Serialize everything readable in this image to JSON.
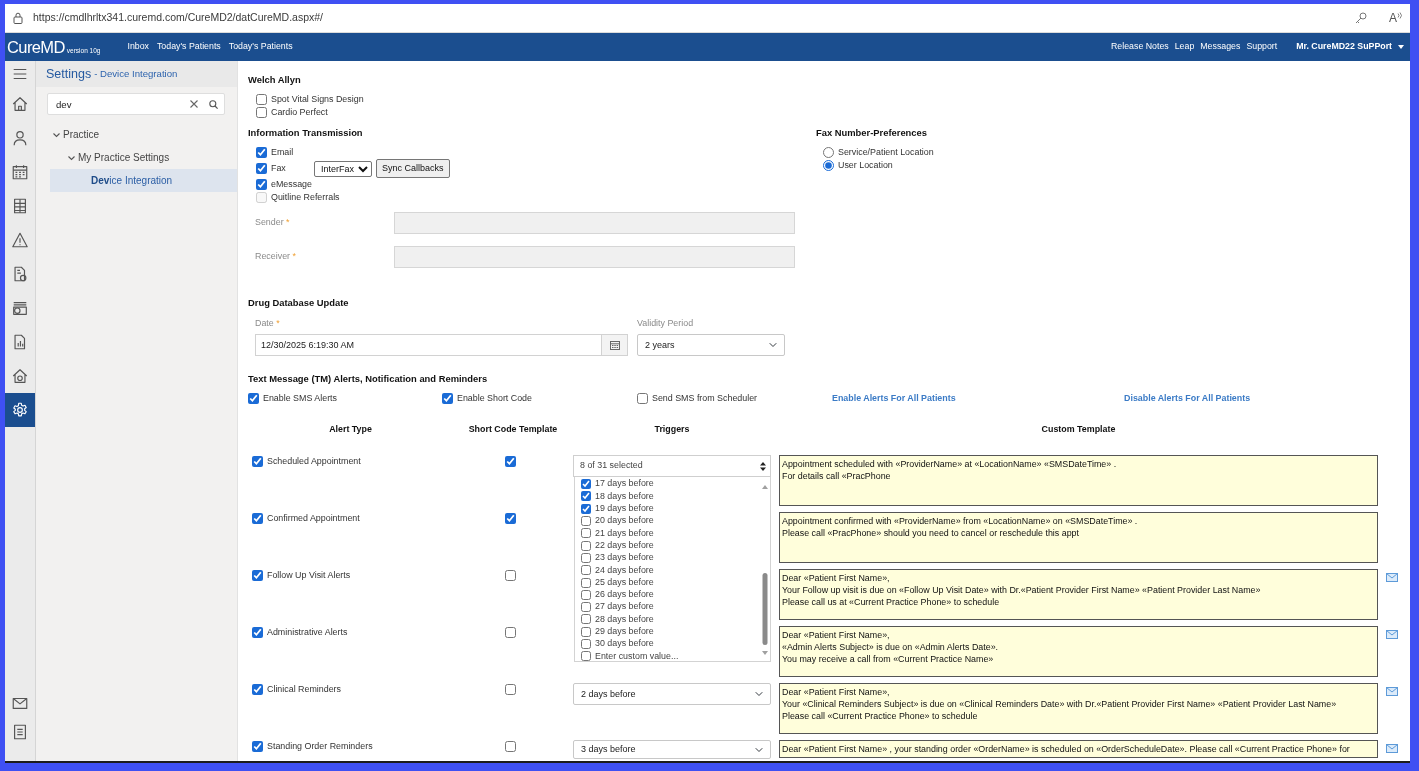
{
  "browser": {
    "url": "https://cmdlhrltx341.curemd.com/CureMD2/datCureMD.aspx#/",
    "read_aloud_label": "A"
  },
  "navbar": {
    "logo": "CureMD",
    "version": "version 10g",
    "links": [
      "Inbox",
      "Today's Patients",
      "Today's Patients"
    ],
    "right_links": [
      "Release Notes",
      "Leap",
      "Messages",
      "Support"
    ],
    "user": "Mr. CureMD22 SuPPort"
  },
  "rail": {
    "items": [
      {
        "kind": "menu",
        "selected": false
      },
      {
        "kind": "home",
        "selected": false
      },
      {
        "kind": "person",
        "selected": false
      },
      {
        "kind": "calendar",
        "selected": false
      },
      {
        "kind": "sheet",
        "selected": false
      },
      {
        "kind": "warning",
        "selected": false
      },
      {
        "kind": "receipt",
        "selected": false
      },
      {
        "kind": "cash",
        "selected": false
      },
      {
        "kind": "report",
        "selected": false
      },
      {
        "kind": "house",
        "selected": false
      },
      {
        "kind": "settings",
        "selected": true
      }
    ],
    "bottom_items": [
      {
        "kind": "mail",
        "selected": false
      },
      {
        "kind": "document",
        "selected": false
      }
    ]
  },
  "settings_panel": {
    "title": "Settings",
    "subtitle": "- Device Integration",
    "search": {
      "value": "dev"
    },
    "tree": [
      {
        "label": "Practice",
        "expanded": true,
        "selected": false,
        "children": [
          {
            "label": "My Practice Settings",
            "expanded": true,
            "selected": false,
            "children": [
              {
                "label": "**Dev**ice Integration",
                "selected": true
              }
            ]
          }
        ]
      }
    ]
  },
  "welch_allyn": {
    "title": "Welch Allyn",
    "devices": [
      {
        "label": "Spot Vital Signs Design",
        "checked": false
      },
      {
        "label": "Cardio Perfect",
        "checked": false
      }
    ]
  },
  "information_transmission": {
    "title": "Information Transmission",
    "channels": [
      {
        "label": "Email",
        "checked": true,
        "disabled": false
      },
      {
        "label": "Fax",
        "checked": true,
        "disabled": false,
        "provider": "InterFax",
        "action": "Sync Callbacks"
      },
      {
        "label": "eMessage",
        "checked": true,
        "disabled": false
      },
      {
        "label": "Quitline Referrals",
        "checked": false,
        "disabled": true
      }
    ],
    "fields": [
      {
        "label": "Sender",
        "required_mark": "*",
        "disabled": true
      },
      {
        "label": "Receiver",
        "required_mark": "*",
        "disabled": true
      }
    ]
  },
  "fax_number_preferences": {
    "title": "Fax Number-Preferences",
    "options": [
      {
        "label": "Service/Patient Location",
        "selected": false
      },
      {
        "label": "User Location",
        "selected": true
      }
    ]
  },
  "drug_database_update": {
    "title": "Drug Database Update",
    "date": {
      "label": "Date",
      "required_mark": "*",
      "value": "12/30/2025 6:19:30 AM"
    },
    "validity_period": {
      "label": "Validity Period",
      "value": "2 years"
    }
  },
  "tm_alerts": {
    "title": "Text Message (TM) Alerts, Notification and Reminders",
    "options": [
      {
        "label": "Enable SMS Alerts",
        "checked": true
      },
      {
        "label": "Enable Short Code",
        "checked": true
      },
      {
        "label": "Send SMS from Scheduler",
        "checked": false
      }
    ],
    "links": [
      "Enable Alerts For All Patients",
      "Disable Alerts For All Patients"
    ],
    "columns": [
      "Alert Type",
      "Short Code Template",
      "Triggers",
      "Custom Template"
    ],
    "rows": [
      {
        "alert_type": "Scheduled Appointment",
        "checked": true,
        "short_code": true,
        "trigger": {
          "kind": "multiselect",
          "summary": "8 of 31 selected",
          "expanded": true,
          "options": [
            {
              "label": "17 days before",
              "checked": true
            },
            {
              "label": "18 days before",
              "checked": true
            },
            {
              "label": "19 days before",
              "checked": true
            },
            {
              "label": "20 days before",
              "checked": false
            },
            {
              "label": "21 days before",
              "checked": false
            },
            {
              "label": "22 days before",
              "checked": false
            },
            {
              "label": "23 days before",
              "checked": false
            },
            {
              "label": "24 days before",
              "checked": false
            },
            {
              "label": "25 days before",
              "checked": false
            },
            {
              "label": "26 days before",
              "checked": false
            },
            {
              "label": "27 days before",
              "checked": false
            },
            {
              "label": "28 days before",
              "checked": false
            },
            {
              "label": "29 days before",
              "checked": false
            },
            {
              "label": "30 days before",
              "checked": false
            },
            {
              "label": "Enter custom value...",
              "checked": false
            }
          ]
        },
        "template": [
          "Appointment scheduled with «ProviderName» at «LocationName» «SMSDateTime» .",
          "For details call «PracPhone"
        ],
        "mail_button": false
      },
      {
        "alert_type": "Confirmed Appointment",
        "checked": true,
        "short_code": true,
        "template": [
          "Appointment confirmed with «ProviderName» from «LocationName» on «SMSDateTime» .",
          "Please call «PracPhone» should you need to cancel or reschedule this appt"
        ],
        "mail_button": false
      },
      {
        "alert_type": "Follow Up Visit Alerts",
        "checked": true,
        "short_code": false,
        "template": [
          "Dear «Patient First Name»,",
          "Your Follow up visit is due on «Follow Up Visit Date» with Dr.«Patient Provider First Name» «Patient Provider Last Name»",
          "Please call us at «Current Practice Phone» to schedule"
        ],
        "mail_button": true
      },
      {
        "alert_type": "Administrative Alerts",
        "checked": true,
        "short_code": false,
        "template": [
          "Dear «Patient First Name»,",
          "«Admin Alerts Subject» is due on «Admin Alerts Date».",
          "You may receive a call from «Current Practice Name»"
        ],
        "mail_button": true
      },
      {
        "alert_type": "Clinical Reminders",
        "checked": true,
        "short_code": false,
        "trigger": {
          "kind": "select",
          "value": "2 days before"
        },
        "template": [
          "Dear «Patient First Name»,",
          "Your «Clinical Reminders Subject» is due on «Clinical Reminders Date» with Dr.«Patient Provider First Name» «Patient Provider Last Name»",
          "Please call «Current Practice Phone» to schedule"
        ],
        "mail_button": true
      },
      {
        "alert_type": "Standing Order Reminders",
        "checked": true,
        "short_code": false,
        "trigger": {
          "kind": "select",
          "value": "3 days before"
        },
        "template": [
          "Dear «Patient First Name» , your standing order «OrderName» is scheduled on «OrderScheduleDate». Please call «Current Practice Phone» for"
        ],
        "mail_button": true
      }
    ]
  }
}
